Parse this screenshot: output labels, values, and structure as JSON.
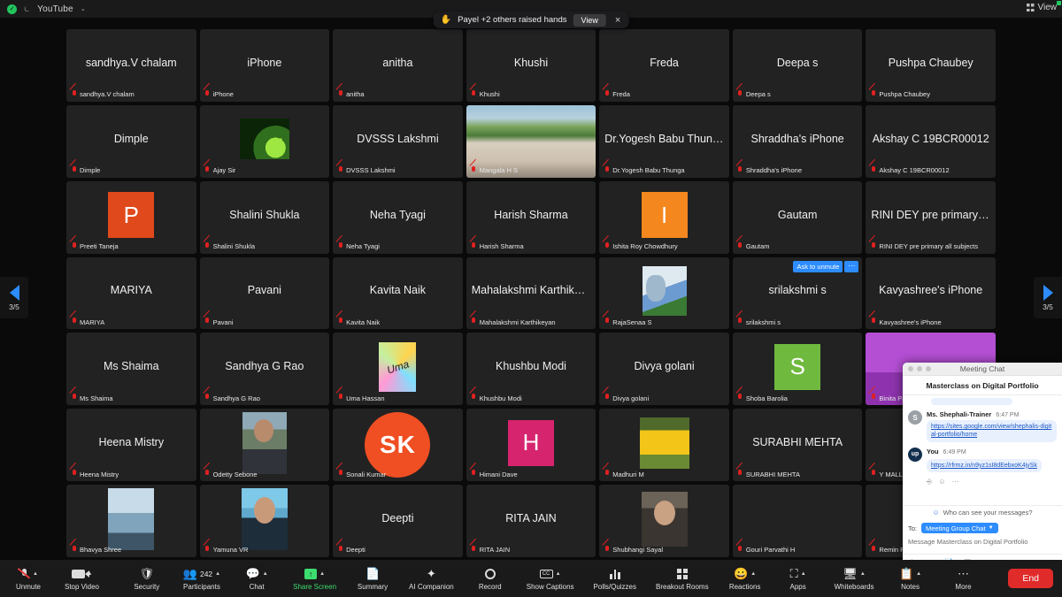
{
  "topbar": {
    "security_status": "secured",
    "recording_icon": "recording-icon",
    "title": "YouTube",
    "caret": "⌄",
    "view_label": "View",
    "view_icon": "grid-view-icon"
  },
  "notification": {
    "hand_icon": "✋",
    "text": "Payel +2 others raised hands",
    "view_button": "View",
    "close_icon": "×"
  },
  "pagination": {
    "left_label": "3/5",
    "right_label": "3/5"
  },
  "gallery": {
    "tiles": [
      {
        "display": "sandhya.V chalam",
        "footer": "sandhya.V chalam",
        "kind": "name",
        "muted": true
      },
      {
        "display": "iPhone",
        "footer": "iPhone",
        "kind": "name",
        "muted": true
      },
      {
        "display": "anitha",
        "footer": "anitha",
        "kind": "name",
        "muted": true
      },
      {
        "display": "Khushi",
        "footer": "Khushi",
        "kind": "name",
        "muted": true
      },
      {
        "display": "Freda",
        "footer": "Freda",
        "kind": "name",
        "muted": true
      },
      {
        "display": "Deepa s",
        "footer": "Deepa s",
        "kind": "name",
        "muted": true
      },
      {
        "display": "Pushpa Chaubey",
        "footer": "Pushpa Chaubey",
        "kind": "name",
        "muted": true
      },
      {
        "display": "Dimple",
        "footer": "Dimple",
        "kind": "name",
        "muted": true
      },
      {
        "display": "",
        "footer": "Ajay Sir",
        "kind": "image",
        "image": "ajay",
        "muted": true
      },
      {
        "display": "DVSSS Lakshmi",
        "footer": "DVSSS Lakshmi",
        "kind": "name",
        "muted": true
      },
      {
        "display": "",
        "footer": "Mangala H S",
        "kind": "video",
        "image": "campus",
        "muted": true
      },
      {
        "display": "Dr.Yogesh Babu Thunga",
        "footer": "Dr.Yogesh Babu Thunga",
        "kind": "name",
        "muted": true
      },
      {
        "display": "Shraddha's iPhone",
        "footer": "Shraddha's iPhone",
        "kind": "name",
        "muted": true
      },
      {
        "display": "Akshay C 19BCR00012",
        "footer": "Akshay C 19BCR00012",
        "kind": "name",
        "muted": true
      },
      {
        "display": "P",
        "footer": "Preeti Taneja",
        "kind": "initial",
        "color": "#e0491c",
        "muted": true
      },
      {
        "display": "Shalini Shukla",
        "footer": "Shalini Shukla",
        "kind": "name",
        "muted": true
      },
      {
        "display": "Neha Tyagi",
        "footer": "Neha Tyagi",
        "kind": "name",
        "muted": true
      },
      {
        "display": "Harish Sharma",
        "footer": "Harish Sharma",
        "kind": "name",
        "muted": true
      },
      {
        "display": "I",
        "footer": "Ishita Roy Chowdhury",
        "kind": "initial",
        "color": "#f5871f",
        "muted": true
      },
      {
        "display": "Gautam",
        "footer": "Gautam",
        "kind": "name",
        "muted": true
      },
      {
        "display": "RINI DEY pre primary all s...",
        "footer": "RINI DEY pre primary all subjects",
        "kind": "name",
        "muted": true
      },
      {
        "display": "MARIYA",
        "footer": "MARIYA",
        "kind": "name",
        "muted": true
      },
      {
        "display": "Pavani",
        "footer": "Pavani",
        "kind": "name",
        "muted": true
      },
      {
        "display": "Kavita Naik",
        "footer": "Kavita Naik",
        "kind": "name",
        "muted": true
      },
      {
        "display": "Mahalakshmi Karthikeyan",
        "footer": "Mahalakshmi Karthikeyan",
        "kind": "name",
        "muted": true
      },
      {
        "display": "",
        "footer": "RajaSenaa S",
        "kind": "image",
        "image": "tom",
        "muted": true
      },
      {
        "display": "srilakshmi s",
        "footer": "srilakshmi s",
        "kind": "name",
        "muted": true,
        "ask_to_unmute": "Ask to unmute",
        "more": "⋯"
      },
      {
        "display": "Kavyashree's iPhone",
        "footer": "Kavyashree's iPhone",
        "kind": "name",
        "muted": true
      },
      {
        "display": "Ms Shaima",
        "footer": "Ms Shaima",
        "kind": "name",
        "muted": true
      },
      {
        "display": "Sandhya G Rao",
        "footer": "Sandhya G Rao",
        "kind": "name",
        "muted": true
      },
      {
        "display": "Uma",
        "footer": "Uma Hassan",
        "kind": "image",
        "image": "uma",
        "muted": true
      },
      {
        "display": "Khushbu Modi",
        "footer": "Khushbu Modi",
        "kind": "name",
        "muted": true
      },
      {
        "display": "Divya golani",
        "footer": "Divya golani",
        "kind": "name",
        "muted": true
      },
      {
        "display": "S",
        "footer": "Shoba Barolia",
        "kind": "initial",
        "color": "#6fb93f",
        "muted": true
      },
      {
        "display": "",
        "footer": "Binita Pande",
        "kind": "video",
        "image": "purple",
        "muted": true
      },
      {
        "display": "Heena Mistry",
        "footer": "Heena Mistry",
        "kind": "name",
        "muted": true
      },
      {
        "display": "",
        "footer": "Odetty Sebone",
        "kind": "image",
        "image": "odetty",
        "muted": true
      },
      {
        "display": "SK",
        "footer": "Sonali Kumar",
        "kind": "circle",
        "color": "#f04e23",
        "muted": true
      },
      {
        "display": "H",
        "footer": "Himani Dave",
        "kind": "initial",
        "color": "#d6246e",
        "muted": true
      },
      {
        "display": "",
        "footer": "Madhuri M",
        "kind": "image",
        "image": "madhuri",
        "muted": true
      },
      {
        "display": "SURABHI MEHTA",
        "footer": "SURABHI MEHTA",
        "kind": "name",
        "muted": true
      },
      {
        "display": "Y MALLI",
        "footer": "Y MALLIKHA",
        "kind": "name",
        "muted": true
      },
      {
        "display": "",
        "footer": "Bhavya Shree",
        "kind": "image",
        "image": "bhavya",
        "muted": true
      },
      {
        "display": "",
        "footer": "Yamuna VR",
        "kind": "image",
        "image": "yamuna",
        "muted": true
      },
      {
        "display": "Deepti",
        "footer": "Deepti",
        "kind": "name",
        "muted": true
      },
      {
        "display": "RITA JAIN",
        "footer": "RITA JAIN",
        "kind": "name",
        "muted": true
      },
      {
        "display": "",
        "footer": "Shubhangi Sayal",
        "kind": "image",
        "image": "shubhangi",
        "muted": true
      },
      {
        "display": "",
        "footer": "Gouri Parvathi H",
        "kind": "name",
        "muted": true
      },
      {
        "display": "",
        "footer": "Remin Paulose",
        "kind": "name",
        "muted": true
      }
    ]
  },
  "chat": {
    "window_title": "Meeting Chat",
    "subject": "Masterclass on Digital Portfolio",
    "messages": [
      {
        "author": "Ms. Shephali-Trainer",
        "time": "6:47 PM",
        "avatar_initial": "S",
        "link": "https://sites.google.com/view/shephalis-digital-portfolio/home"
      },
      {
        "author": "You",
        "time": "6:49 PM",
        "avatar_initial": "up",
        "link": "https://rfrmz.in/n9yz1sI8dEebxoK4jySk"
      }
    ],
    "actions": {
      "reply_icon": "⎆",
      "react_icon": "☺",
      "more_icon": "⋯"
    },
    "privacy_note": "Who can see your messages?",
    "privacy_icon": "privacy-person-icon",
    "to_label": "To:",
    "to_value": "Meeting Group Chat",
    "compose_placeholder": "Message Masterclass on Digital Portfolio",
    "compose_icons": [
      "format-icon",
      "emoji-icon",
      "file-icon",
      "screenshot-icon",
      "more-icon"
    ]
  },
  "toolbar": {
    "left": [
      {
        "label": "Unmute",
        "icon": "mic-muted-icon",
        "chevron": true
      },
      {
        "label": "Stop Video",
        "icon": "camera-icon",
        "chevron": true
      }
    ],
    "center": [
      {
        "label": "Security",
        "icon": "shield-icon",
        "chevron": false
      },
      {
        "label": "Participants",
        "icon": "participants-icon",
        "chevron": true,
        "count": "242"
      },
      {
        "label": "Chat",
        "icon": "chat-bubble-icon",
        "chevron": true
      },
      {
        "label": "Share Screen",
        "icon": "share-screen-icon",
        "chevron": true,
        "highlight": true
      },
      {
        "label": "Summary",
        "icon": "summary-icon",
        "chevron": false
      },
      {
        "label": "AI Companion",
        "icon": "ai-sparkle-icon",
        "chevron": false
      },
      {
        "label": "Record",
        "icon": "record-icon",
        "chevron": false
      },
      {
        "label": "Show Captions",
        "icon": "captions-icon",
        "chevron": true
      },
      {
        "label": "Polls/Quizzes",
        "icon": "polls-icon",
        "chevron": false
      },
      {
        "label": "Breakout Rooms",
        "icon": "breakout-rooms-icon",
        "chevron": false
      },
      {
        "label": "Reactions",
        "icon": "reactions-icon",
        "chevron": true
      },
      {
        "label": "Apps",
        "icon": "apps-icon",
        "chevron": true
      },
      {
        "label": "Whiteboards",
        "icon": "whiteboard-icon",
        "chevron": true
      },
      {
        "label": "Notes",
        "icon": "notes-icon",
        "chevron": true
      },
      {
        "label": "More",
        "icon": "more-dots-icon",
        "chevron": false
      }
    ],
    "end_button": "End"
  },
  "colors": {
    "accent_blue": "#2d8cff",
    "end_red": "#e02b2b",
    "share_green": "#3ddc6e",
    "tile_bg": "#222222",
    "app_bg": "#0a0a0a"
  }
}
